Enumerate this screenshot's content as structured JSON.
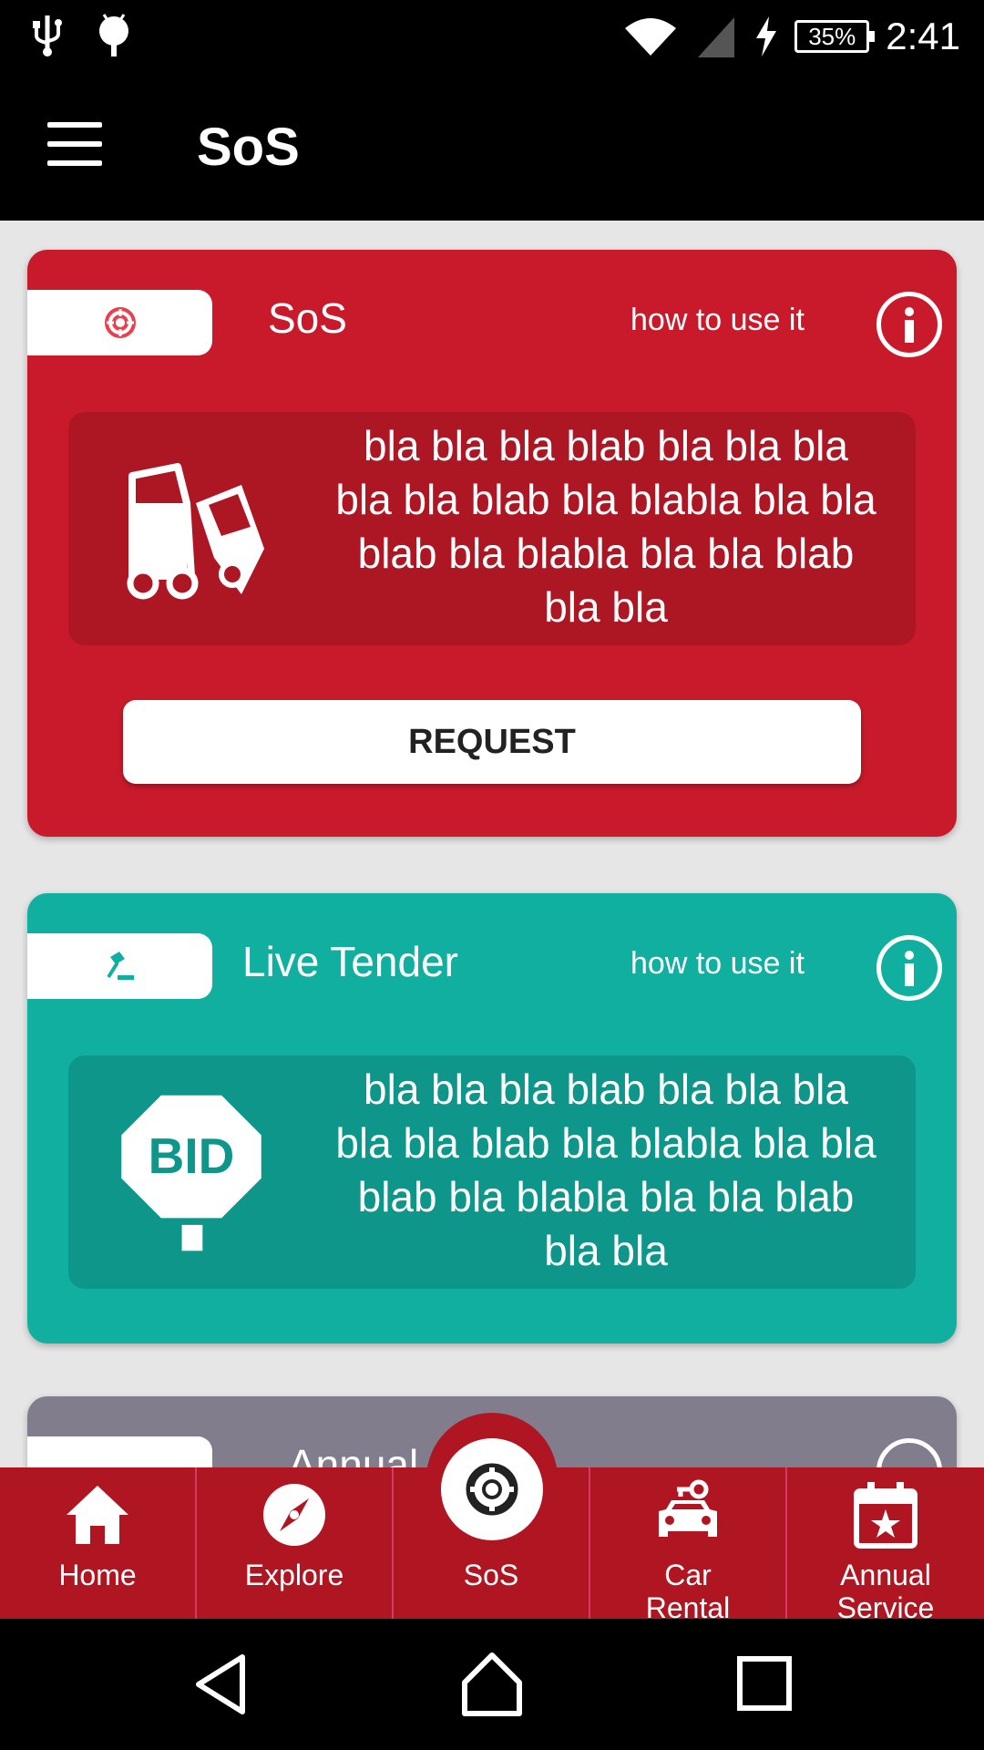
{
  "status_bar": {
    "time": "2:41",
    "battery": "35%"
  },
  "app_bar": {
    "title": "SoS"
  },
  "cards": [
    {
      "title": "SoS",
      "how_to": "how to use it",
      "description": "bla bla bla blab bla bla bla bla bla blab bla blabla bla bla blab bla blabla bla bla blab bla bla",
      "button": "REQUEST",
      "color": "#c91a2b"
    },
    {
      "title": "Live Tender",
      "how_to": "how to use it",
      "description": "bla bla bla blab bla bla bla bla bla blab bla blabla bla bla blab bla blabla bla bla blab bla bla",
      "icon_text": "BID",
      "color": "#11afa0"
    },
    {
      "title": "Annual",
      "color": "#817d8c"
    }
  ],
  "bottom_nav": {
    "items": [
      {
        "label": "Home",
        "icon": "home-icon"
      },
      {
        "label": "Explore",
        "icon": "compass-icon"
      },
      {
        "label": "SoS",
        "icon": "lifebuoy-icon",
        "active": true
      },
      {
        "label": "Car\nRental",
        "icon": "car-key-icon"
      },
      {
        "label": "Annual\nService",
        "icon": "calendar-star-icon"
      }
    ]
  },
  "colors": {
    "nav": "#b01522",
    "sos": "#c91a2b",
    "tender": "#11afa0",
    "annual": "#817d8c"
  }
}
